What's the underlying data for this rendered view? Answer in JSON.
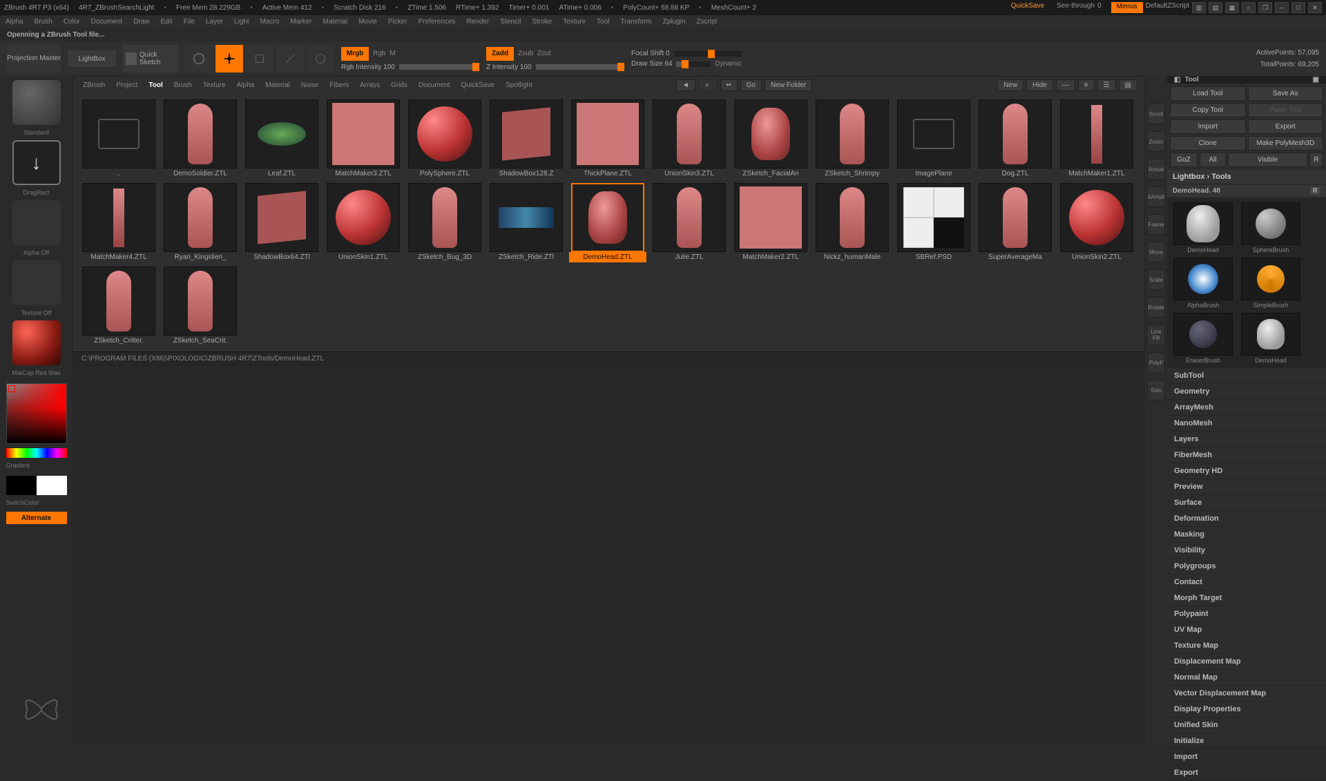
{
  "title": {
    "app": "ZBrush 4R7 P3 (x64)",
    "doc": "4R7_ZBrushSearchLight",
    "mem": "Free Mem 28.229GB",
    "activemem": "Active Mem 412",
    "scratch": "Scratch Disk 216",
    "ztime": "ZTime 1.506",
    "rtime": "RTime+ 1.392",
    "timer": "Timer+ 0.001",
    "atime": "ATime+ 0.006",
    "poly": "PolyCount+ 68.88 KP",
    "mesh": "MeshCount+ 2",
    "quicksave": "QuickSave",
    "see": "See-through",
    "seeval": "0",
    "menus": "Menus",
    "script": "DefaultZScript"
  },
  "menu": [
    "Alpha",
    "Brush",
    "Color",
    "Document",
    "Draw",
    "Edit",
    "File",
    "Layer",
    "Light",
    "Macro",
    "Marker",
    "Material",
    "Movie",
    "Picker",
    "Preferences",
    "Render",
    "Stencil",
    "Stroke",
    "Texture",
    "Tool",
    "Transform",
    "Zplugin",
    "Zscript"
  ],
  "status": "Openning a ZBrush Tool file...",
  "toolbar": {
    "projection": "Projection Master",
    "lightbox": "LightBox",
    "qsketch": "Quick Sketch",
    "mrgb": "Mrgb",
    "rgb": "Rgb",
    "m": "M",
    "rgbint": "Rgb Intensity 100",
    "zadd": "Zadd",
    "zsub": "Zsub",
    "zcut": "Zcut",
    "zint": "Z Intensity 100",
    "focal": "Focal Shift 0",
    "draw": "Draw Size 64",
    "dynamic": "Dynamic",
    "active": "ActivePoints: 57,095",
    "total": "TotalPoints: 69,205"
  },
  "left": {
    "standard": "Standard",
    "dragrect": "DragRect",
    "alpha": "Alpha Off",
    "texture": "Texture Off",
    "matcap": "MatCap Red Wax",
    "gradient": "Gradient",
    "switch": "SwitchColor",
    "alternate": "Alternate"
  },
  "lb": {
    "tabs": [
      "ZBrush",
      "Project",
      "Tool",
      "Brush",
      "Texture",
      "Alpha",
      "Material",
      "Noise",
      "Fibers",
      "Arrays",
      "Grids",
      "Document",
      "QuickSave",
      "Spotlight"
    ],
    "activeTab": "Tool",
    "go": "Go",
    "newfolder": "New Folder",
    "new": "New",
    "hide": "Hide",
    "items": [
      {
        "label": "..",
        "t": "folder"
      },
      {
        "label": "DemoSoldier.ZTL",
        "t": "fig"
      },
      {
        "label": "Leaf.ZTL",
        "t": "leaf"
      },
      {
        "label": "MatchMaker3.ZTL",
        "t": "sq"
      },
      {
        "label": "PolySphere.ZTL",
        "t": "sphere"
      },
      {
        "label": "ShadowBox128.Z",
        "t": "cube"
      },
      {
        "label": "ThickPlane.ZTL",
        "t": "sq"
      },
      {
        "label": "UnionSkin3.ZTL",
        "t": "blob"
      },
      {
        "label": "ZSketch_FacialAn",
        "t": "head"
      },
      {
        "label": "ZSketch_Shrimpy",
        "t": "shrimp"
      },
      {
        "label": "ImagePlane",
        "t": "folder"
      },
      {
        "label": "Dog.ZTL",
        "t": "fig"
      },
      {
        "label": "MatchMaker1.ZTL",
        "t": "bar"
      },
      {
        "label": "MatchMaker4.ZTL",
        "t": "bar"
      },
      {
        "label": "Ryan_Kingslien_",
        "t": "fig"
      },
      {
        "label": "ShadowBox64.ZTl",
        "t": "cube"
      },
      {
        "label": "UnionSkin1.ZTL",
        "t": "sphere"
      },
      {
        "label": "ZSketch_Bug_3D",
        "t": "bug"
      },
      {
        "label": "ZSketch_Ride.ZTl",
        "t": "ride"
      },
      {
        "label": "DemoHead.ZTL",
        "t": "head"
      },
      {
        "label": "Julie.ZTL",
        "t": "fig"
      },
      {
        "label": "MatchMaker2.ZTL",
        "t": "sq"
      },
      {
        "label": "Nickz_humanMale",
        "t": "fig"
      },
      {
        "label": "SBRef.PSD",
        "t": "ref"
      },
      {
        "label": "SuperAverageMa",
        "t": "fig"
      },
      {
        "label": "UnionSkin2.ZTL",
        "t": "sphere"
      },
      {
        "label": "ZSketch_Critter.",
        "t": "crit"
      },
      {
        "label": "ZSketch_SeaCrit.",
        "t": "sea"
      }
    ],
    "selected": 19,
    "path": "C:\\PROGRAM FILES (X86)\\PIXOLOGIC\\ZBRUSH 4R7\\ZTools/DemoHead.ZTL"
  },
  "ribbon": [
    "Scroll",
    "Zoom",
    "Actual",
    "AAHalf",
    "Frame",
    "Move",
    "Scale",
    "Rotate",
    "Line Fill",
    "PolyF",
    "Solo"
  ],
  "tool": {
    "head": "Tool",
    "btns": {
      "load": "Load Tool",
      "save": "Save As",
      "copy": "Copy Tool",
      "paste": "Paste Tool",
      "import": "Import",
      "export": "Export",
      "clone": "Clone",
      "make": "Make PolyMesh3D",
      "goz": "GoZ",
      "all": "All",
      "visible": "Visible",
      "r": "R"
    },
    "lbtools": "Lightbox › Tools",
    "active": "DemoHead. 48",
    "items": [
      {
        "label": "DemoHead",
        "t": "head"
      },
      {
        "label": "SphereBrush",
        "t": "sphere"
      },
      {
        "label": "AlphaBrush",
        "t": "alpha"
      },
      {
        "label": "SimpleBrush",
        "t": "simple"
      },
      {
        "label": "EraserBrush",
        "t": "eraser"
      },
      {
        "label": "DemoHead",
        "t": "head2"
      }
    ],
    "panels": [
      "SubTool",
      "Geometry",
      "ArrayMesh",
      "NanoMesh",
      "Layers",
      "FiberMesh",
      "Geometry HD",
      "Preview",
      "Surface",
      "Deformation",
      "Masking",
      "Visibility",
      "Polygroups",
      "Contact",
      "Morph Target",
      "Polypaint",
      "UV Map",
      "Texture Map",
      "Displacement Map",
      "Normal Map",
      "Vector Displacement Map",
      "Display Properties",
      "Unified Skin",
      "Initialize",
      "Import",
      "Export"
    ]
  }
}
